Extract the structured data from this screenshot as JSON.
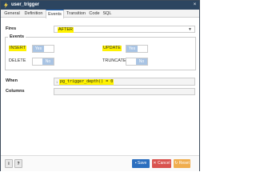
{
  "window": {
    "title": "user_trigger",
    "close_glyph": "×"
  },
  "tabs": [
    {
      "label": "General"
    },
    {
      "label": "Definition"
    },
    {
      "label": "Events"
    },
    {
      "label": "Transition"
    },
    {
      "label": "Code"
    },
    {
      "label": "SQL"
    }
  ],
  "form": {
    "fires_label": "Fires",
    "fires_value": "AFTER",
    "events_legend": "Events",
    "insert_label": "INSERT",
    "insert_toggle": "Yes",
    "update_label": "UPDATE",
    "update_toggle": "Yes",
    "delete_label": "DELETE",
    "delete_toggle": "No",
    "truncate_label": "TRUNCATE",
    "truncate_toggle": "No",
    "when_label": "When",
    "when_value": "pg_trigger_depth() = 0",
    "when_line_no": "1",
    "columns_label": "Columns"
  },
  "footer": {
    "info_label": "i",
    "help_label": "?",
    "save_label": "Save",
    "cancel_label": "Cancel",
    "reset_label": "Reset"
  },
  "colors": {
    "titlebar": "#2c4560",
    "highlight": "#fff200",
    "toggle_knob": "#a9c4e4",
    "save": "#2c6fbf",
    "cancel": "#d9534f",
    "reset": "#f0ad4e"
  },
  "icons": {
    "title_icon": "trigger-icon",
    "close": "close-icon",
    "select_caret": "chevron-down-icon"
  }
}
